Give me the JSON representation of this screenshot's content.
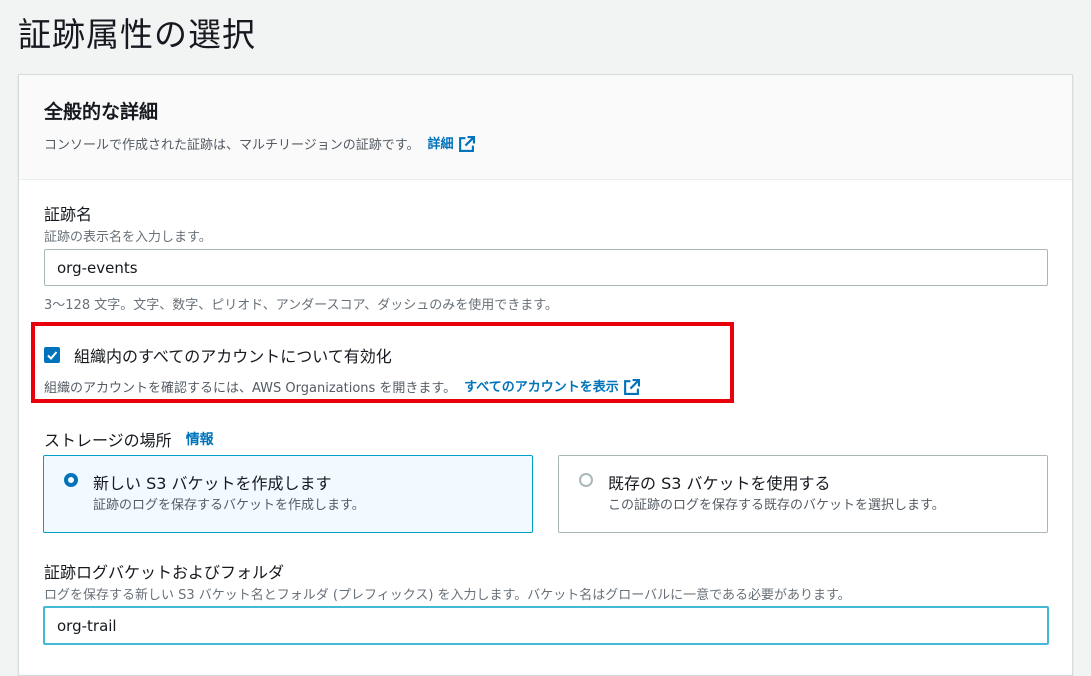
{
  "page": {
    "title": "証跡属性の選択"
  },
  "general": {
    "title": "全般的な詳細",
    "description": "コンソールで作成された証跡は、マルチリージョンの証跡です。",
    "learn_more": "詳細"
  },
  "trail_name": {
    "label": "証跡名",
    "description": "証跡の表示名を入力します。",
    "value": "org-events",
    "constraint": "3～128 文字。文字、数字、ピリオド、アンダースコア、ダッシュのみを使用できます。"
  },
  "organization": {
    "checkbox_label": "組織内のすべてのアカウントについて有効化",
    "checked": true,
    "description": "組織のアカウントを確認するには、AWS Organizations を開きます。",
    "link": "すべてのアカウントを表示"
  },
  "storage": {
    "label": "ストレージの場所",
    "info": "情報",
    "options": [
      {
        "title": "新しい S3 バケットを作成します",
        "description": "証跡のログを保存するバケットを作成します。",
        "selected": true
      },
      {
        "title": "既存の S3 バケットを使用する",
        "description": "この証跡のログを保存する既存のバケットを選択します。",
        "selected": false
      }
    ]
  },
  "bucket": {
    "label": "証跡ログバケットおよびフォルダ",
    "description": "ログを保存する新しい S3 バケット名とフォルダ (プレフィックス) を入力します。バケット名はグローバルに一意である必要があります。",
    "value": "org-trail"
  },
  "colors": {
    "link": "#0073bb",
    "highlight": "#e8000a",
    "focus": "#44b9d6"
  }
}
